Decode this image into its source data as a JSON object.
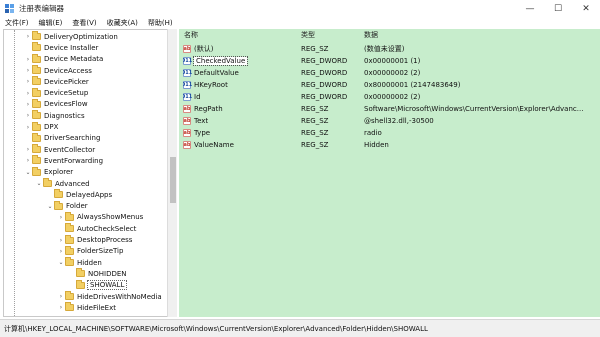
{
  "window": {
    "title": "注册表编辑器",
    "minimize_glyph": "—",
    "maximize_glyph": "☐",
    "close_glyph": "✕"
  },
  "menu": [
    "文件(F)",
    "编辑(E)",
    "查看(V)",
    "收藏夹(A)",
    "帮助(H)"
  ],
  "tree": {
    "items": [
      {
        "label": "DeliveryOptimization",
        "level": 0,
        "expander": "›"
      },
      {
        "label": "Device Installer",
        "level": 0,
        "expander": ""
      },
      {
        "label": "Device Metadata",
        "level": 0,
        "expander": "›"
      },
      {
        "label": "DeviceAccess",
        "level": 0,
        "expander": "›"
      },
      {
        "label": "DevicePicker",
        "level": 0,
        "expander": "›"
      },
      {
        "label": "DeviceSetup",
        "level": 0,
        "expander": "›"
      },
      {
        "label": "DevicesFlow",
        "level": 0,
        "expander": "›"
      },
      {
        "label": "Diagnostics",
        "level": 0,
        "expander": "›"
      },
      {
        "label": "DPX",
        "level": 0,
        "expander": "›"
      },
      {
        "label": "DriverSearching",
        "level": 0,
        "expander": ""
      },
      {
        "label": "EventCollector",
        "level": 0,
        "expander": "›"
      },
      {
        "label": "EventForwarding",
        "level": 0,
        "expander": "›"
      },
      {
        "label": "Explorer",
        "level": 0,
        "expander": "⌄"
      },
      {
        "label": "Advanced",
        "level": 1,
        "expander": "⌄"
      },
      {
        "label": "DelayedApps",
        "level": 2,
        "expander": ""
      },
      {
        "label": "Folder",
        "level": 2,
        "expander": "⌄"
      },
      {
        "label": "AlwaysShowMenus",
        "level": 3,
        "expander": "›"
      },
      {
        "label": "AutoCheckSelect",
        "level": 3,
        "expander": ""
      },
      {
        "label": "DesktopProcess",
        "level": 3,
        "expander": "›"
      },
      {
        "label": "FolderSizeTip",
        "level": 3,
        "expander": "›"
      },
      {
        "label": "Hidden",
        "level": 3,
        "expander": "⌄"
      },
      {
        "label": "NOHIDDEN",
        "level": 4,
        "expander": ""
      },
      {
        "label": "SHOWALL",
        "level": 4,
        "expander": "",
        "selected": true
      },
      {
        "label": "HideDrivesWithNoMedia",
        "level": 3,
        "expander": "›"
      },
      {
        "label": "HideFileExt",
        "level": 3,
        "expander": "›"
      }
    ]
  },
  "list": {
    "columns": {
      "name": "名称",
      "type": "类型",
      "data": "数据"
    },
    "rows": [
      {
        "icon": "ab",
        "kind": "sz",
        "name": "(默认)",
        "type": "REG_SZ",
        "data": "(数值未设置)"
      },
      {
        "icon": "011",
        "kind": "dword",
        "name": "CheckedValue",
        "type": "REG_DWORD",
        "data": "0x00000001 (1)",
        "focus": true
      },
      {
        "icon": "011",
        "kind": "dword",
        "name": "DefaultValue",
        "type": "REG_DWORD",
        "data": "0x00000002 (2)"
      },
      {
        "icon": "011",
        "kind": "dword",
        "name": "HKeyRoot",
        "type": "REG_DWORD",
        "data": "0x80000001 (2147483649)"
      },
      {
        "icon": "011",
        "kind": "dword",
        "name": "Id",
        "type": "REG_DWORD",
        "data": "0x00000002 (2)"
      },
      {
        "icon": "ab",
        "kind": "sz",
        "name": "RegPath",
        "type": "REG_SZ",
        "data": "Software\\Microsoft\\Windows\\CurrentVersion\\Explorer\\Advanc..."
      },
      {
        "icon": "ab",
        "kind": "sz",
        "name": "Text",
        "type": "REG_SZ",
        "data": "@shell32.dll,-30500"
      },
      {
        "icon": "ab",
        "kind": "sz",
        "name": "Type",
        "type": "REG_SZ",
        "data": "radio"
      },
      {
        "icon": "ab",
        "kind": "sz",
        "name": "ValueName",
        "type": "REG_SZ",
        "data": "Hidden"
      }
    ]
  },
  "status": {
    "path": "计算机\\HKEY_LOCAL_MACHINE\\SOFTWARE\\Microsoft\\Windows\\CurrentVersion\\Explorer\\Advanced\\Folder\\Hidden\\SHOWALL"
  },
  "colors": {
    "list_background": "#c7edcc",
    "folder_fill": "#f2cf63"
  }
}
